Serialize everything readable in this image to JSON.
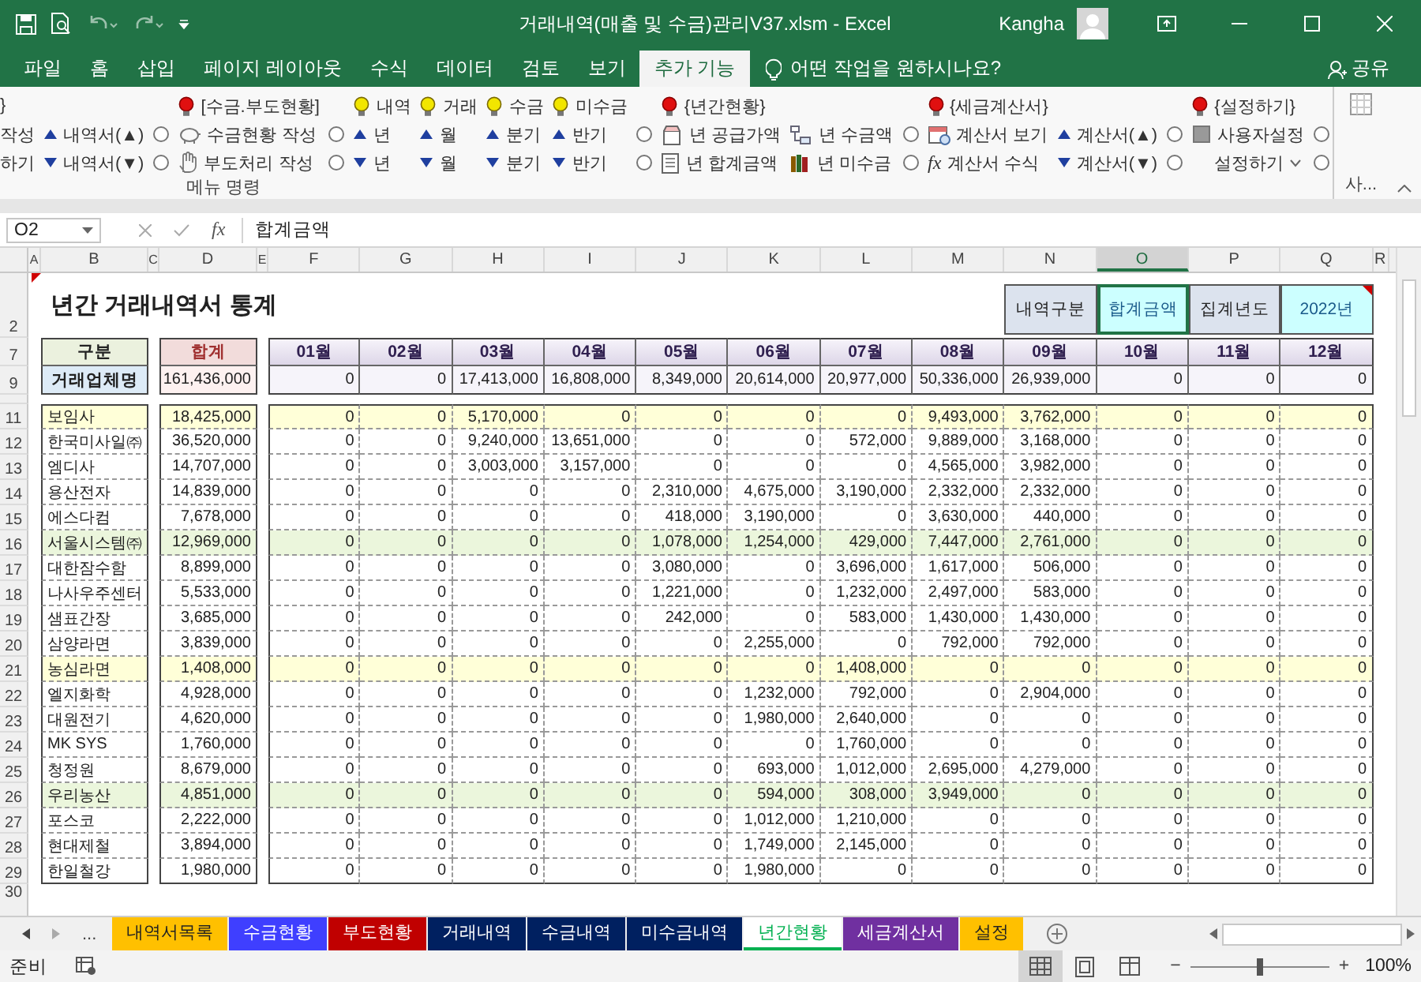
{
  "window": {
    "title": "거래내역(매출 및 수금)관리V37.xlsm  -  Excel",
    "user": "Kangha"
  },
  "menu_tabs": [
    {
      "label": "파일",
      "selected": false
    },
    {
      "label": "홈",
      "selected": false
    },
    {
      "label": "삽입",
      "selected": false
    },
    {
      "label": "페이지 레이아웃",
      "selected": false
    },
    {
      "label": "수식",
      "selected": false
    },
    {
      "label": "데이터",
      "selected": false
    },
    {
      "label": "검토",
      "selected": false
    },
    {
      "label": "보기",
      "selected": false
    },
    {
      "label": "추가 기능",
      "selected": true
    }
  ],
  "tell_me": {
    "placeholder": "어떤 작업을 원하시나요?"
  },
  "share": "공유",
  "ribbon": {
    "columns": [
      {
        "top": {
          "kind": "plaintitle",
          "label": "}"
        },
        "middle": {
          "kind": "plain",
          "label": "작성"
        },
        "bottom": {
          "kind": "plain",
          "label": "하기"
        }
      },
      {
        "middle": {
          "kind": "up",
          "label": "내역서(▲)"
        },
        "bottom": {
          "kind": "down",
          "label": "내역서(▼)"
        }
      },
      {
        "middle": {
          "kind": "radio",
          "checked": false
        },
        "bottom": {
          "kind": "radio",
          "checked": false
        }
      },
      {
        "top": {
          "kind": "redtitle",
          "label": "[수금.부도현황]"
        },
        "middle": {
          "kind": "piggy",
          "label": "수금현황 작성"
        },
        "bottom": {
          "kind": "hand",
          "label": "부도처리 작성"
        }
      },
      {
        "middle": {
          "kind": "radio",
          "checked": false
        },
        "bottom": {
          "kind": "radio",
          "checked": false
        }
      },
      {
        "top": {
          "kind": "yellowtitle",
          "label": "내역"
        },
        "middle": {
          "kind": "up",
          "label": "년"
        },
        "bottom": {
          "kind": "down",
          "label": "년"
        }
      },
      {
        "top": {
          "kind": "yellowtitle",
          "label": "거래"
        },
        "middle": {
          "kind": "up",
          "label": "월"
        },
        "bottom": {
          "kind": "down",
          "label": "월"
        }
      },
      {
        "top": {
          "kind": "yellowtitle",
          "label": "수금"
        },
        "middle": {
          "kind": "up",
          "label": "분기"
        },
        "bottom": {
          "kind": "down",
          "label": "분기"
        }
      },
      {
        "top": {
          "kind": "yellowtitle",
          "label": "미수금"
        },
        "middle": {
          "kind": "up",
          "label": "반기"
        },
        "bottom": {
          "kind": "down",
          "label": "반기"
        }
      },
      {
        "middle": {
          "kind": "radio",
          "checked": false
        },
        "bottom": {
          "kind": "radio",
          "checked": false
        }
      },
      {
        "top": {
          "kind": "redtitle",
          "label": "{년간현황}"
        },
        "middle": {
          "kind": "box",
          "label": "년 공급가액"
        },
        "bottom": {
          "kind": "document",
          "label": "년 합계금액"
        }
      },
      {
        "middle": {
          "kind": "tree",
          "label": "년 수금액"
        },
        "bottom": {
          "kind": "books",
          "label": "년 미수금"
        }
      },
      {
        "middle": {
          "kind": "radio",
          "checked": false
        },
        "bottom": {
          "kind": "radio",
          "checked": false
        }
      },
      {
        "top": {
          "kind": "redtitle",
          "label": "{세금계산서}"
        },
        "middle": {
          "kind": "calendar",
          "label": "계산서 보기"
        },
        "bottom": {
          "kind": "formula",
          "symbol": "fx",
          "label": "계산서 수식"
        }
      },
      {
        "middle": {
          "kind": "up",
          "label": "계산서(▲)"
        },
        "bottom": {
          "kind": "down",
          "label": "계산서(▼)"
        }
      },
      {
        "middle": {
          "kind": "radio",
          "checked": false
        },
        "bottom": {
          "kind": "radio",
          "checked": false
        }
      },
      {
        "top": {
          "kind": "redtitle",
          "label": "{설정하기}"
        },
        "middle": {
          "kind": "square",
          "label": "사용자설정"
        },
        "bottom": {
          "kind": "dropdown",
          "label": "설정하기"
        }
      },
      {
        "middle": {
          "kind": "radio",
          "checked": false
        },
        "bottom": {
          "kind": "radio",
          "checked": false
        }
      }
    ],
    "group_label": "메뉴 명령",
    "side_label": "사..."
  },
  "formula_bar": {
    "name_box": "O2",
    "function_symbol": "fx",
    "value": "합계금액"
  },
  "sheet": {
    "column_headers": [
      {
        "label": "A",
        "selected": false
      },
      {
        "label": "B",
        "selected": false
      },
      {
        "label": "C",
        "selected": false
      },
      {
        "label": "D",
        "selected": false
      },
      {
        "label": "E",
        "selected": false
      },
      {
        "label": "F",
        "selected": false
      },
      {
        "label": "G",
        "selected": false
      },
      {
        "label": "H",
        "selected": false
      },
      {
        "label": "I",
        "selected": false
      },
      {
        "label": "J",
        "selected": false
      },
      {
        "label": "K",
        "selected": false
      },
      {
        "label": "L",
        "selected": false
      },
      {
        "label": "M",
        "selected": false
      },
      {
        "label": "N",
        "selected": false
      },
      {
        "label": "O",
        "selected": true
      },
      {
        "label": "P",
        "selected": false
      },
      {
        "label": "Q",
        "selected": false
      },
      {
        "label": "R",
        "selected": false
      }
    ],
    "title_row": "2",
    "title": "년간 거래내역서 통계",
    "title_comment": true,
    "info_cells": [
      {
        "kind": "label",
        "label": "내역구분",
        "selected": false,
        "comment": false
      },
      {
        "kind": "value",
        "label": "합계금액",
        "selected": true,
        "comment": false
      },
      {
        "kind": "label",
        "label": "집계년도",
        "selected": false,
        "comment": false
      },
      {
        "kind": "value",
        "label": "2022년",
        "selected": false,
        "comment": true
      }
    ],
    "header_row": {
      "row": "7",
      "category": "구분",
      "total": "합계",
      "months": [
        "01월",
        "02월",
        "03월",
        "04월",
        "05월",
        "06월",
        "07월",
        "08월",
        "09월",
        "10월",
        "11월",
        "12월"
      ]
    },
    "totals_row": {
      "row": "9",
      "category": "거래업체명",
      "total": "161,436,000",
      "months": [
        "0",
        "0",
        "17,413,000",
        "16,808,000",
        "8,349,000",
        "20,614,000",
        "20,977,000",
        "50,336,000",
        "26,939,000",
        "0",
        "0",
        "0"
      ]
    },
    "rows": [
      {
        "row": "11",
        "company": "보임사",
        "total": "18,425,000",
        "color": "#ffffd8",
        "months": [
          "0",
          "0",
          "5,170,000",
          "0",
          "0",
          "0",
          "0",
          "9,493,000",
          "3,762,000",
          "0",
          "0",
          "0"
        ]
      },
      {
        "row": "12",
        "company": "한국미사일㈜",
        "total": "36,520,000",
        "color": "#ffffff",
        "months": [
          "0",
          "0",
          "9,240,000",
          "13,651,000",
          "0",
          "0",
          "572,000",
          "9,889,000",
          "3,168,000",
          "0",
          "0",
          "0"
        ]
      },
      {
        "row": "13",
        "company": "엠디사",
        "total": "14,707,000",
        "color": "#ffffff",
        "months": [
          "0",
          "0",
          "3,003,000",
          "3,157,000",
          "0",
          "0",
          "0",
          "4,565,000",
          "3,982,000",
          "0",
          "0",
          "0"
        ]
      },
      {
        "row": "14",
        "company": "용산전자",
        "total": "14,839,000",
        "color": "#ffffff",
        "months": [
          "0",
          "0",
          "0",
          "0",
          "2,310,000",
          "4,675,000",
          "3,190,000",
          "2,332,000",
          "2,332,000",
          "0",
          "0",
          "0"
        ]
      },
      {
        "row": "15",
        "company": "에스다컴",
        "total": "7,678,000",
        "color": "#ffffff",
        "months": [
          "0",
          "0",
          "0",
          "0",
          "418,000",
          "3,190,000",
          "0",
          "3,630,000",
          "440,000",
          "0",
          "0",
          "0"
        ]
      },
      {
        "row": "16",
        "company": "서울시스템㈜",
        "total": "12,969,000",
        "color": "#ebf6dc",
        "months": [
          "0",
          "0",
          "0",
          "0",
          "1,078,000",
          "1,254,000",
          "429,000",
          "7,447,000",
          "2,761,000",
          "0",
          "0",
          "0"
        ]
      },
      {
        "row": "17",
        "company": "대한잠수함",
        "total": "8,899,000",
        "color": "#ffffff",
        "months": [
          "0",
          "0",
          "0",
          "0",
          "3,080,000",
          "0",
          "3,696,000",
          "1,617,000",
          "506,000",
          "0",
          "0",
          "0"
        ]
      },
      {
        "row": "18",
        "company": "나사우주센터",
        "total": "5,533,000",
        "color": "#ffffff",
        "months": [
          "0",
          "0",
          "0",
          "0",
          "1,221,000",
          "0",
          "1,232,000",
          "2,497,000",
          "583,000",
          "0",
          "0",
          "0"
        ]
      },
      {
        "row": "19",
        "company": "샘표간장",
        "total": "3,685,000",
        "color": "#ffffff",
        "months": [
          "0",
          "0",
          "0",
          "0",
          "242,000",
          "0",
          "583,000",
          "1,430,000",
          "1,430,000",
          "0",
          "0",
          "0"
        ]
      },
      {
        "row": "20",
        "company": "삼양라면",
        "total": "3,839,000",
        "color": "#ffffff",
        "months": [
          "0",
          "0",
          "0",
          "0",
          "0",
          "2,255,000",
          "0",
          "792,000",
          "792,000",
          "0",
          "0",
          "0"
        ]
      },
      {
        "row": "21",
        "company": "농심라면",
        "total": "1,408,000",
        "color": "#ffffd8",
        "months": [
          "0",
          "0",
          "0",
          "0",
          "0",
          "0",
          "1,408,000",
          "0",
          "0",
          "0",
          "0",
          "0"
        ]
      },
      {
        "row": "22",
        "company": "엘지화학",
        "total": "4,928,000",
        "color": "#ffffff",
        "months": [
          "0",
          "0",
          "0",
          "0",
          "0",
          "1,232,000",
          "792,000",
          "0",
          "2,904,000",
          "0",
          "0",
          "0"
        ]
      },
      {
        "row": "23",
        "company": "대원전기",
        "total": "4,620,000",
        "color": "#ffffff",
        "months": [
          "0",
          "0",
          "0",
          "0",
          "0",
          "1,980,000",
          "2,640,000",
          "0",
          "0",
          "0",
          "0",
          "0"
        ]
      },
      {
        "row": "24",
        "company": "MK SYS",
        "total": "1,760,000",
        "color": "#ffffff",
        "months": [
          "0",
          "0",
          "0",
          "0",
          "0",
          "0",
          "1,760,000",
          "0",
          "0",
          "0",
          "0",
          "0"
        ]
      },
      {
        "row": "25",
        "company": "청정원",
        "total": "8,679,000",
        "color": "#ffffff",
        "months": [
          "0",
          "0",
          "0",
          "0",
          "0",
          "693,000",
          "1,012,000",
          "2,695,000",
          "4,279,000",
          "0",
          "0",
          "0"
        ]
      },
      {
        "row": "26",
        "company": "우리농산",
        "total": "4,851,000",
        "color": "#ebf6dc",
        "months": [
          "0",
          "0",
          "0",
          "0",
          "0",
          "594,000",
          "308,000",
          "3,949,000",
          "0",
          "0",
          "0",
          "0"
        ]
      },
      {
        "row": "27",
        "company": "포스코",
        "total": "2,222,000",
        "color": "#ffffff",
        "months": [
          "0",
          "0",
          "0",
          "0",
          "0",
          "1,012,000",
          "1,210,000",
          "0",
          "0",
          "0",
          "0",
          "0"
        ]
      },
      {
        "row": "28",
        "company": "현대제철",
        "total": "3,894,000",
        "color": "#ffffff",
        "months": [
          "0",
          "0",
          "0",
          "0",
          "0",
          "1,749,000",
          "2,145,000",
          "0",
          "0",
          "0",
          "0",
          "0"
        ]
      },
      {
        "row": "29",
        "company": "한일철강",
        "total": "1,980,000",
        "color": "#ffffff",
        "months": [
          "0",
          "0",
          "0",
          "0",
          "0",
          "1,980,000",
          "0",
          "0",
          "0",
          "0",
          "0",
          "0"
        ]
      }
    ],
    "empty_rows": [
      "30"
    ]
  },
  "sheet_tabs": {
    "more": "...",
    "tabs": [
      {
        "label": "내역서목록",
        "color": "#ffc000",
        "selected": false
      },
      {
        "label": "수금현황",
        "color": "#3f3fff",
        "selected": false
      },
      {
        "label": "부도현황",
        "color": "#c00000",
        "selected": false
      },
      {
        "label": "거래내역",
        "color": "#002060",
        "selected": false
      },
      {
        "label": "수금내역",
        "color": "#002060",
        "selected": false
      },
      {
        "label": "미수금내역",
        "color": "#002060",
        "selected": false
      },
      {
        "label": "년간현황",
        "color": "#00b050",
        "selected": true
      },
      {
        "label": "세금계산서",
        "color": "#7030a0",
        "selected": false
      },
      {
        "label": "설정",
        "color": "#ffc000",
        "selected": false
      }
    ]
  },
  "status_bar": {
    "status": "준비",
    "views": [
      {
        "kind": "normal",
        "selected": true
      },
      {
        "kind": "page_layout",
        "selected": false
      },
      {
        "kind": "page_break",
        "selected": false
      }
    ],
    "zoom": {
      "minus": "−",
      "plus": "+",
      "level": 0.5,
      "reading": "100%"
    }
  }
}
